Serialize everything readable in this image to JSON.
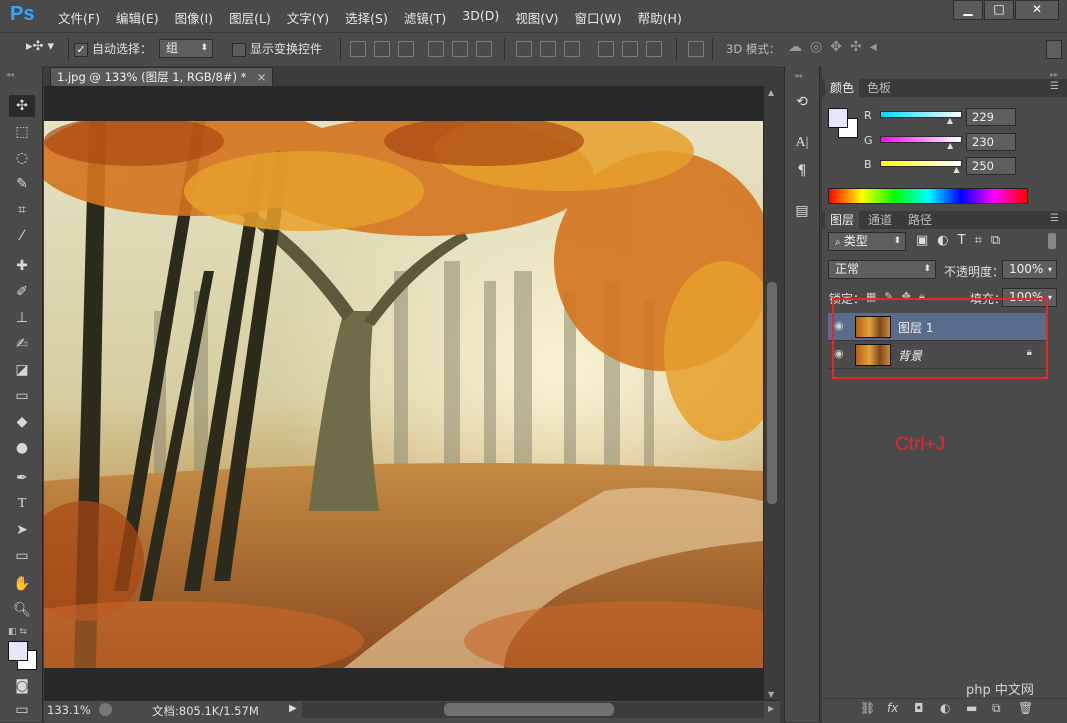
{
  "app": {
    "logo": "Ps"
  },
  "menu": [
    "文件(F)",
    "编辑(E)",
    "图像(I)",
    "图层(L)",
    "文字(Y)",
    "选择(S)",
    "滤镜(T)",
    "3D(D)",
    "视图(V)",
    "窗口(W)",
    "帮助(H)"
  ],
  "window_controls": {
    "minimize": "▁",
    "maximize": "□",
    "close": "✕"
  },
  "options": {
    "auto_select_label": "自动选择：",
    "auto_select_checked": true,
    "auto_select_value": "组",
    "show_transform_label": "显示变换控件",
    "mode_3d_label": "3D 模式："
  },
  "document": {
    "tab_title": "1.jpg @ 133% (图层 1, RGB/8#) *",
    "tab_close": "×"
  },
  "status": {
    "zoom": "133.1%",
    "doc_info": "文档:805.1K/1.57M"
  },
  "color_panel": {
    "tabs": [
      "颜色",
      "色板"
    ],
    "channels": [
      {
        "name": "R",
        "value": "229",
        "fraction": 0.898,
        "color": "#00d8ff"
      },
      {
        "name": "G",
        "value": "230",
        "fraction": 0.902,
        "color": "#ff00ff"
      },
      {
        "name": "B",
        "value": "250",
        "fraction": 0.98,
        "color": "#ffff00"
      }
    ],
    "foreground": "#e5e6fa"
  },
  "layers_panel": {
    "tabs": [
      "图层",
      "通道",
      "路径"
    ],
    "filter_label": "类型",
    "blend_mode": "正常",
    "opacity_label": "不透明度：",
    "opacity_value": "100%",
    "lock_label": "锁定：",
    "fill_label": "填充：",
    "fill_value": "100%",
    "layers": [
      {
        "name": "图层 1",
        "selected": true,
        "locked": false
      },
      {
        "name": "背景",
        "selected": false,
        "locked": true
      }
    ]
  },
  "annotation": {
    "text": "Ctrl+J",
    "color": "#e8262a"
  },
  "watermark": "php 中文网"
}
